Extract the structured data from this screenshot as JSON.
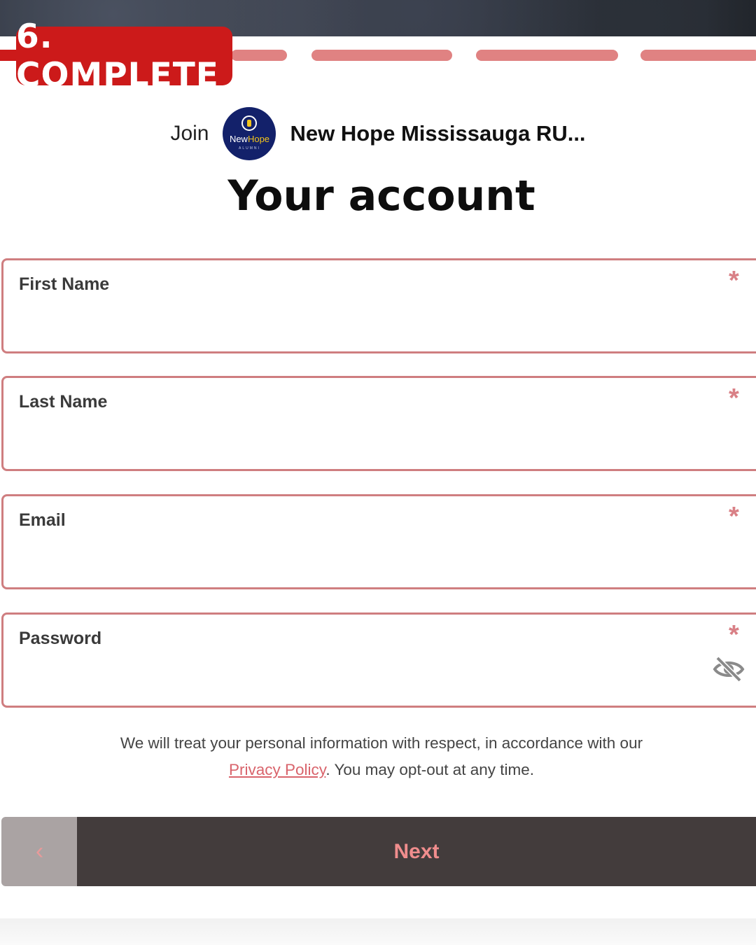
{
  "step_badge": "6. COMPLETE",
  "header": {
    "join_label": "Join",
    "org_name": "New Hope Mississauga RU...",
    "logo": {
      "text_part1": "New",
      "text_part2": "Hope",
      "subtext": "ALUMNI"
    }
  },
  "page_title": "Your account",
  "fields": {
    "first_name": {
      "label": "First Name",
      "value": "",
      "required_mark": "*"
    },
    "last_name": {
      "label": "Last Name",
      "value": "",
      "required_mark": "*"
    },
    "email": {
      "label": "Email",
      "value": "",
      "required_mark": "*"
    },
    "password": {
      "label": "Password",
      "value": "",
      "required_mark": "*",
      "toggle_icon": "eye-slash-icon"
    }
  },
  "consent": {
    "text_before": "We will treat your personal information with respect, in accordance with our",
    "link_text": "Privacy Policy",
    "text_after": ". You may opt-out at any time."
  },
  "nav": {
    "back_icon": "‹",
    "next_label": "Next"
  },
  "colors": {
    "brand_red": "#cc1a1a",
    "progress_pink": "#e08282",
    "field_border": "#cf7e80",
    "button_dark": "#433c3c",
    "button_text": "#f08d8d"
  }
}
